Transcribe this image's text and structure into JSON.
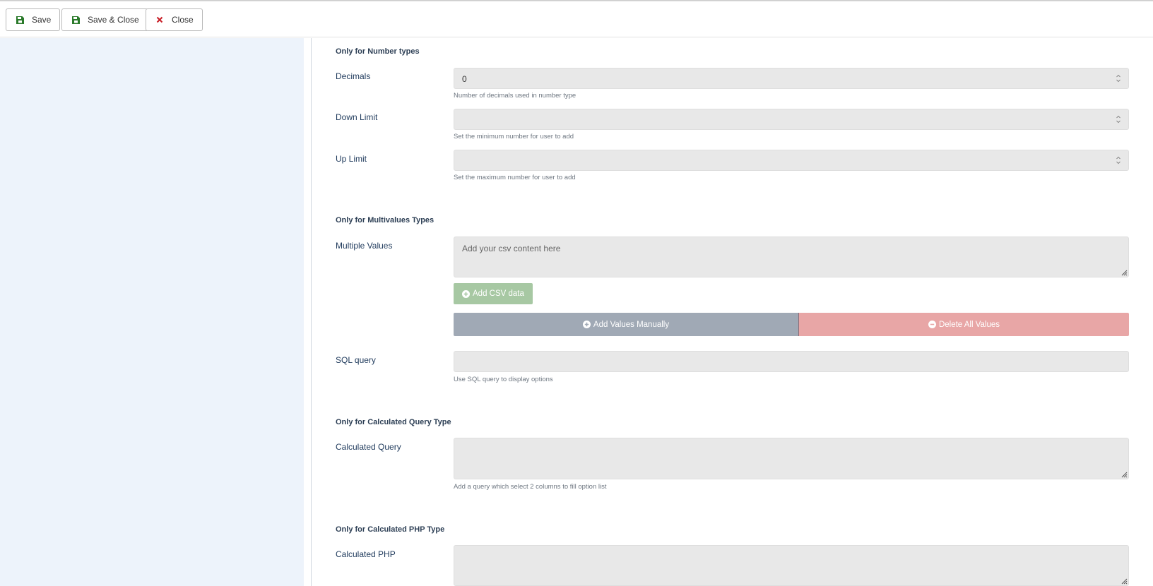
{
  "toolbar": {
    "save_label": "Save",
    "save_close_label": "Save & Close",
    "close_label": "Close"
  },
  "number_section": {
    "title": "Only for Number types",
    "decimals": {
      "label": "Decimals",
      "value": "0",
      "help": "Number of decimals used in number type"
    },
    "down_limit": {
      "label": "Down Limit",
      "value": "",
      "help": "Set the minimum number for user to add"
    },
    "up_limit": {
      "label": "Up Limit",
      "value": "",
      "help": "Set the maximum number for user to add"
    }
  },
  "multivalues_section": {
    "title": "Only for Multivalues Types",
    "multiple_values": {
      "label": "Multiple Values",
      "placeholder": "Add your csv content here"
    },
    "add_csv_label": "Add CSV data",
    "add_manual_label": "Add Values Manually",
    "delete_all_label": "Delete All Values",
    "sql_query": {
      "label": "SQL query",
      "value": "",
      "help": "Use SQL query to display options"
    }
  },
  "calc_query_section": {
    "title": "Only for Calculated Query Type",
    "label": "Calculated Query",
    "help": "Add a query which select 2 columns to fill option list"
  },
  "calc_php_section": {
    "title": "Only for Calculated PHP Type",
    "label": "Calculated PHP"
  },
  "colors": {
    "save_icon": "#2a7a2a",
    "close_icon": "#c81d25",
    "add_csv_bg": "#a7c8a3",
    "add_manual_bg": "#a0a9b5",
    "delete_bg": "#e8a6a6",
    "sidebar_bg": "#edf3fb"
  }
}
